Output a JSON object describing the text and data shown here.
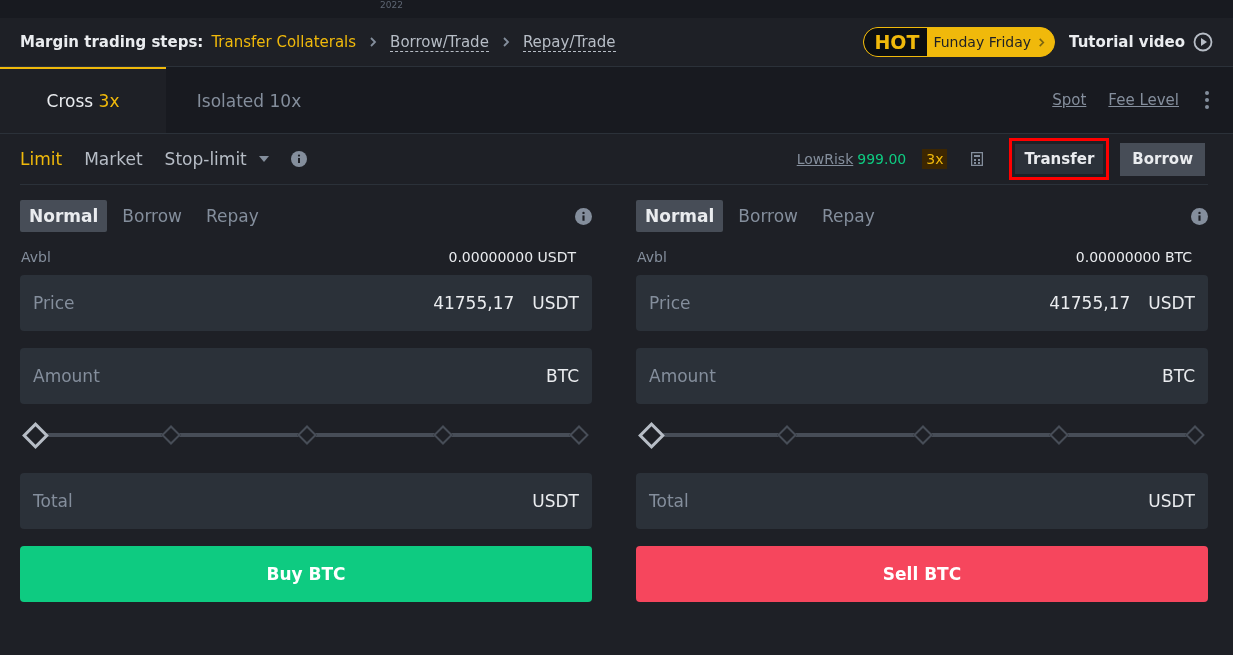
{
  "chart_axis": {
    "labels": [
      "2022"
    ]
  },
  "steps": {
    "title": "Margin trading steps:",
    "items": [
      {
        "label": "Transfer Collaterals",
        "selected": true
      },
      {
        "label": "Borrow/Trade",
        "selected": false
      },
      {
        "label": "Repay/Trade",
        "selected": false
      }
    ],
    "promo": {
      "badge": "HOT",
      "label": "Funday Friday"
    },
    "tutorial": "Tutorial video"
  },
  "mode_tabs": [
    {
      "label": "Cross",
      "leverage": "3x",
      "selected": true
    },
    {
      "label": "Isolated",
      "leverage": "10x",
      "selected": false
    }
  ],
  "top_links": [
    "Spot",
    "Fee Level"
  ],
  "order_types": [
    {
      "label": "Limit",
      "selected": true,
      "dropdown": false
    },
    {
      "label": "Market",
      "selected": false,
      "dropdown": false
    },
    {
      "label": "Stop-limit",
      "selected": false,
      "dropdown": true
    }
  ],
  "risk": {
    "label": "LowRisk",
    "value": "999.00",
    "leverage": "3x"
  },
  "actions": [
    {
      "label": "Transfer",
      "highlighted": true
    },
    {
      "label": "Borrow",
      "highlighted": false
    }
  ],
  "panels": [
    {
      "modes": [
        {
          "label": "Normal",
          "selected": true
        },
        {
          "label": "Borrow",
          "selected": false
        },
        {
          "label": "Repay",
          "selected": false
        }
      ],
      "avbl_label": "Avbl",
      "avbl_value": "0.00000000 USDT",
      "fields": [
        {
          "kind": "input",
          "label": "Price",
          "value": "41755,17",
          "unit": "USDT"
        },
        {
          "kind": "input",
          "label": "Amount",
          "unit": "BTC"
        },
        {
          "kind": "slider",
          "level": 0
        },
        {
          "kind": "input",
          "label": "Total",
          "unit": "USDT"
        }
      ],
      "button": {
        "label": "Buy BTC",
        "kind": "buy"
      }
    },
    {
      "modes": [
        {
          "label": "Normal",
          "selected": true
        },
        {
          "label": "Borrow",
          "selected": false
        },
        {
          "label": "Repay",
          "selected": false
        }
      ],
      "avbl_label": "Avbl",
      "avbl_value": "0.00000000 BTC",
      "fields": [
        {
          "kind": "input",
          "label": "Price",
          "value": "41755,17",
          "unit": "USDT"
        },
        {
          "kind": "input",
          "label": "Amount",
          "unit": "BTC"
        },
        {
          "kind": "slider",
          "level": 0
        },
        {
          "kind": "input",
          "label": "Total",
          "unit": "USDT"
        }
      ],
      "button": {
        "label": "Sell BTC",
        "kind": "sell"
      }
    }
  ]
}
